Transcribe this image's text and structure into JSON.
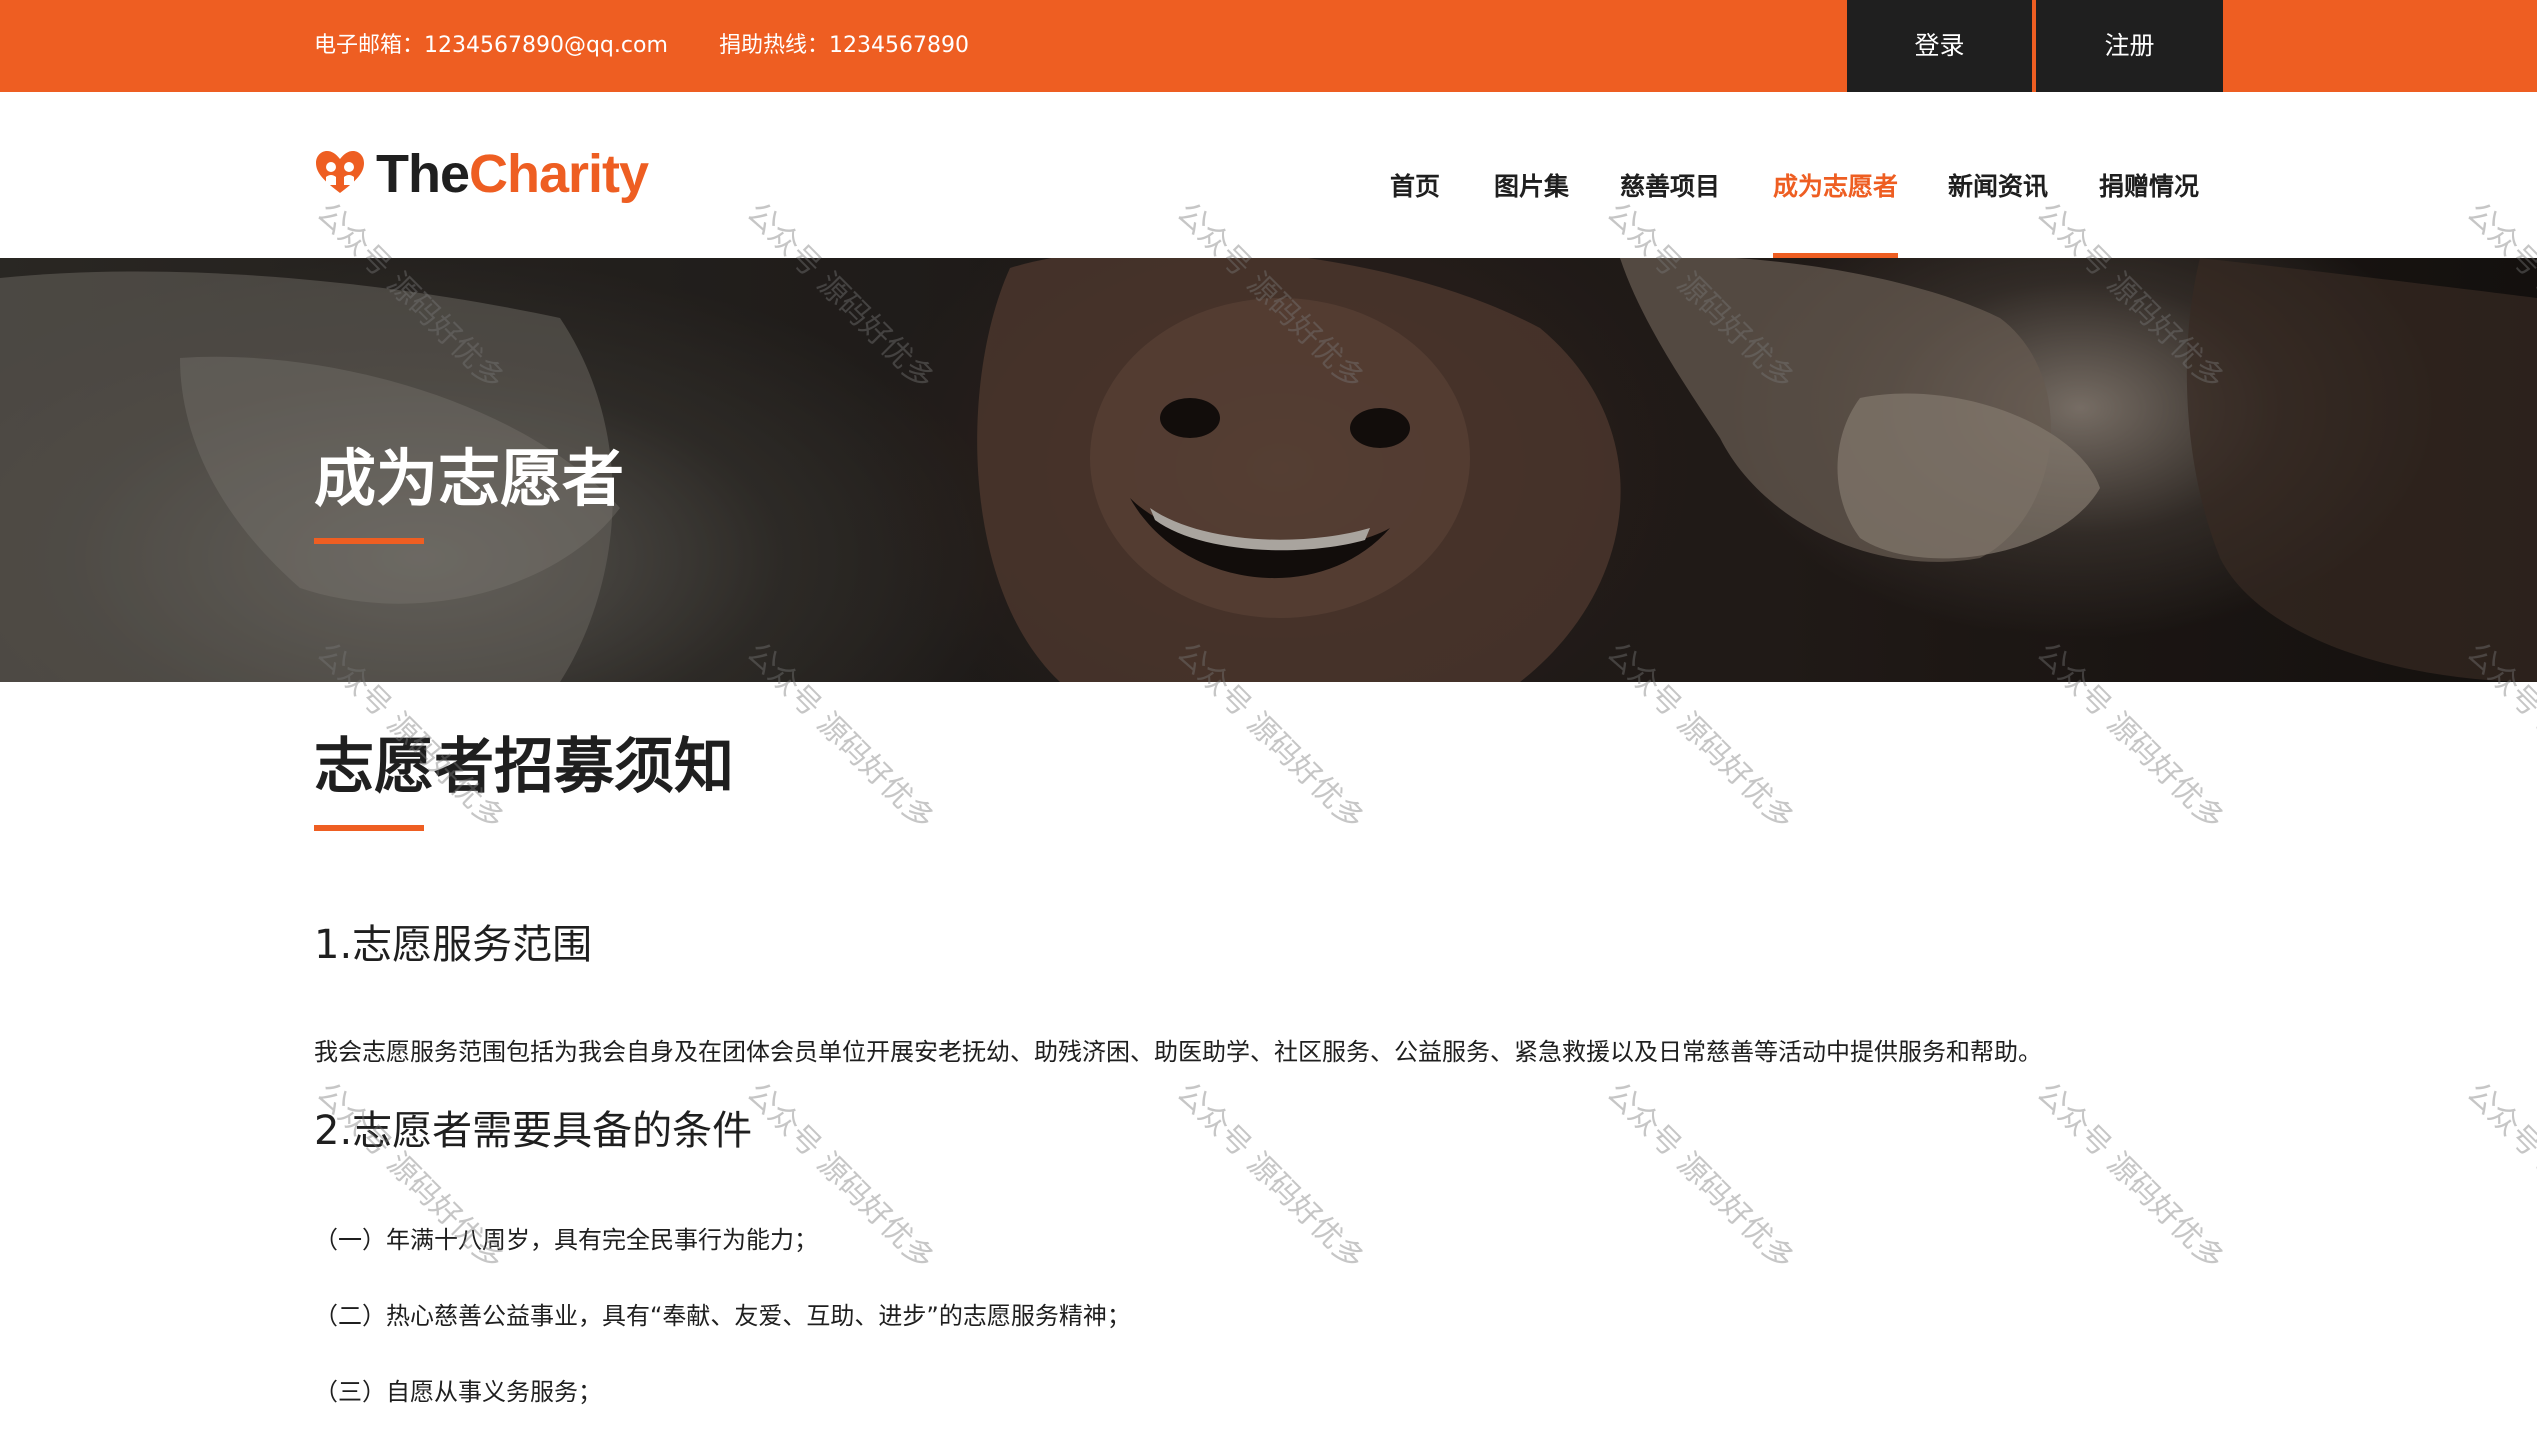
{
  "topbar": {
    "email_text": "电子邮箱：1234567890@qq.com",
    "hotline_text": "捐助热线：1234567890",
    "login_label": "登录",
    "register_label": "注册"
  },
  "brand": {
    "name_part1": "The",
    "name_part2": "Charity"
  },
  "nav": {
    "items": [
      {
        "label": "首页",
        "active": false
      },
      {
        "label": "图片集",
        "active": false
      },
      {
        "label": "慈善项目",
        "active": false
      },
      {
        "label": "成为志愿者",
        "active": true
      },
      {
        "label": "新闻资讯",
        "active": false
      },
      {
        "label": "捐赠情况",
        "active": false
      }
    ]
  },
  "hero": {
    "title": "成为志愿者"
  },
  "content": {
    "title": "志愿者招募须知",
    "section1_heading": "1.志愿服务范围",
    "section1_text": "我会志愿服务范围包括为我会自身及在团体会员单位开展安老抚幼、助残济困、助医助学、社区服务、公益服务、紧急救援以及日常慈善等活动中提供服务和帮助。",
    "section2_heading": "2.志愿者需要具备的条件",
    "conditions": [
      "（一）年满十八周岁，具有完全民事行为能力；",
      "（二）热心慈善公益事业，具有“奉献、友爱、互助、进步”的志愿服务精神；",
      "（三）自愿从事义务服务；"
    ]
  },
  "watermark": {
    "text": "公众号 源码好优多"
  },
  "colors": {
    "accent": "#ee5e22",
    "dark": "#1f1f1f",
    "white": "#ffffff"
  }
}
